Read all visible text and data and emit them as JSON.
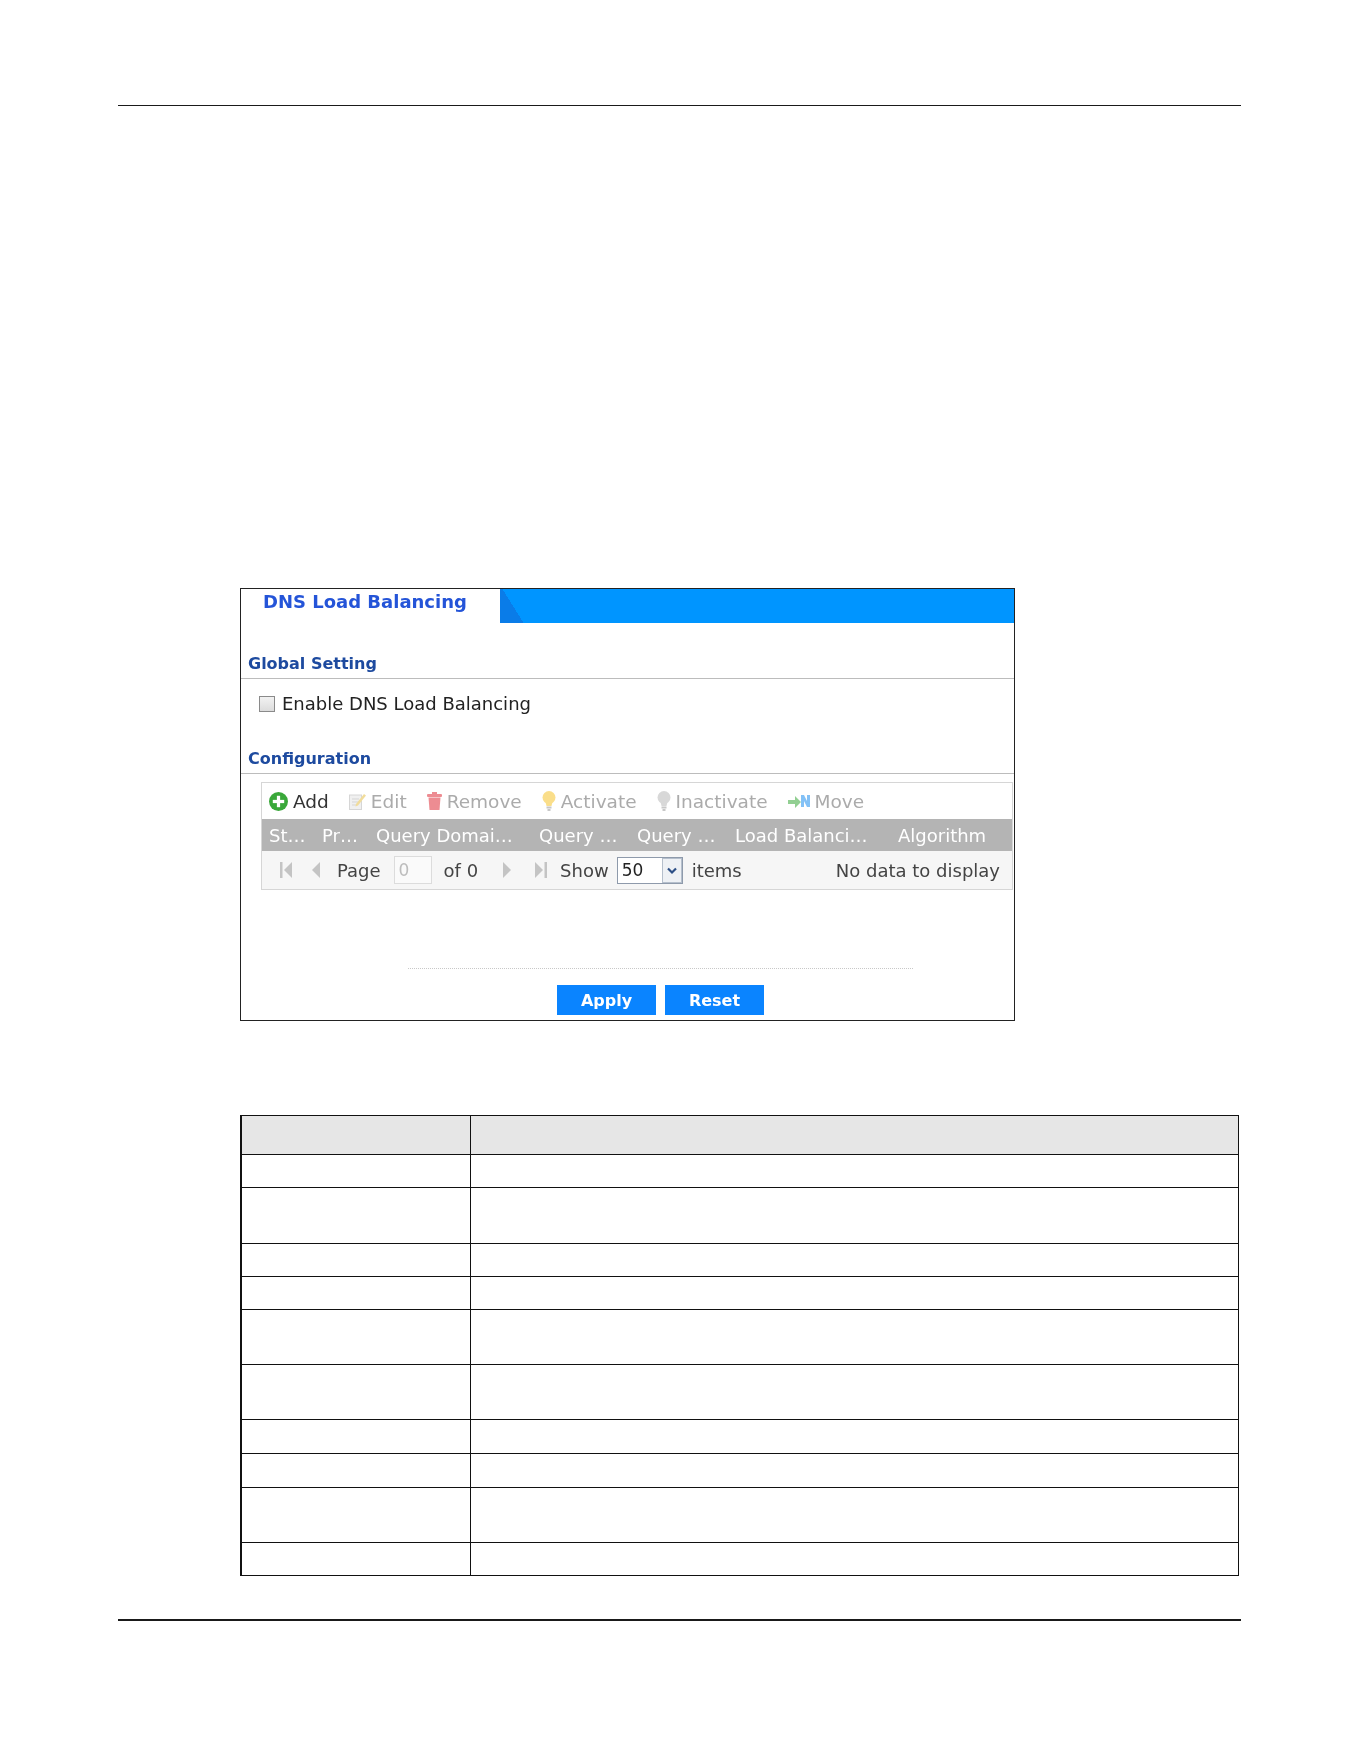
{
  "panel": {
    "title": "DNS Load Balancing"
  },
  "global_setting": {
    "heading": "Global Setting",
    "checkbox": {
      "label": "Enable DNS Load Balancing",
      "checked": false
    }
  },
  "configuration": {
    "heading": "Configuration",
    "toolbar": [
      {
        "kind": "add",
        "label": "Add",
        "disabled": false
      },
      {
        "kind": "edit",
        "label": "Edit",
        "disabled": true
      },
      {
        "kind": "remove",
        "label": "Remove",
        "disabled": true
      },
      {
        "kind": "activate",
        "label": "Activate",
        "disabled": true
      },
      {
        "kind": "inactivate",
        "label": "Inactivate",
        "disabled": true
      },
      {
        "kind": "move",
        "label": "Move",
        "disabled": true
      }
    ],
    "columns": [
      "St…",
      "Pr…",
      "Query Domai…",
      "Query …",
      "Query …",
      "Load Balanci…",
      "Algorithm"
    ],
    "pager": {
      "disabled": true,
      "page_label": "Page",
      "page": "0",
      "of": "of 0",
      "show_label": "Show",
      "per_page": "50",
      "items_label": "items",
      "status": "No data to display"
    }
  },
  "buttons": [
    "Apply",
    "Reset"
  ]
}
